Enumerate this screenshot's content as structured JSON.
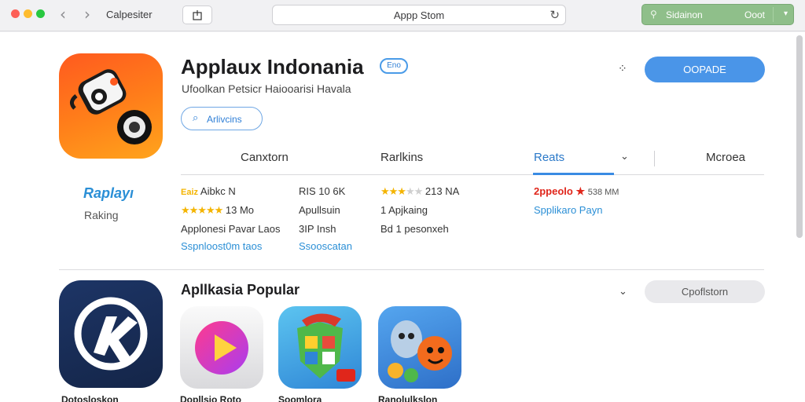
{
  "window": {
    "title": "Calpesiter",
    "address": "Appp Stom",
    "account_name": "Sidainon",
    "account_value": "Ooot"
  },
  "app": {
    "title": "Applaux Indonania",
    "badge": "Eno",
    "subtitle": "Ufoolkan Petsicr Haiooarisi Havala",
    "pill_label": "Arlivcins",
    "get_label": "OOPADE",
    "side_name": "Raplayı",
    "side_sub": "Raking"
  },
  "tabs": [
    "Canxtorn",
    "Rarlkins",
    "Reats",
    "Mcroea"
  ],
  "stats": {
    "col1": {
      "row1": "Aibkc N",
      "row1_prefix": "Eaiz",
      "row2": "13 Mo",
      "row3": "Applonesi Pavar Laos",
      "row4": "Sspnloost0m taos"
    },
    "col2": {
      "row1": "RIS 10 6K",
      "row2": "Apullsuin",
      "row3": "3IP Insh",
      "row4": "Ssooscatan"
    },
    "col3": {
      "row1": "213 NA",
      "row2": "1 Apjkaing",
      "row3": "Bd 1 pesonxeh"
    },
    "col4": {
      "row1_red": "2ppeolo ★",
      "row1": "538 MM",
      "row2": "Spplikaro Payn"
    }
  },
  "ratings": {
    "col1_row2": 5,
    "col3_row1": 3.5
  },
  "popular": {
    "title": "Apllkasia Popular",
    "button_label": "Cpoflstorn"
  },
  "bottom_labels": [
    "Dotosloskon",
    "Dopllsio Roto",
    "Soomlora",
    "Ranolulkslon"
  ],
  "colors": {
    "accent": "#4a95e8",
    "account_bg": "#8fbf8a",
    "app_icon": "#ff6a1c",
    "link": "#2b8fd6"
  },
  "icons": {
    "back": "chevron-left-icon",
    "forward": "chevron-right-icon",
    "share": "share-icon",
    "reload": "reload-icon",
    "account": "person-icon",
    "search": "search-icon",
    "more": "more-dots-icon"
  }
}
